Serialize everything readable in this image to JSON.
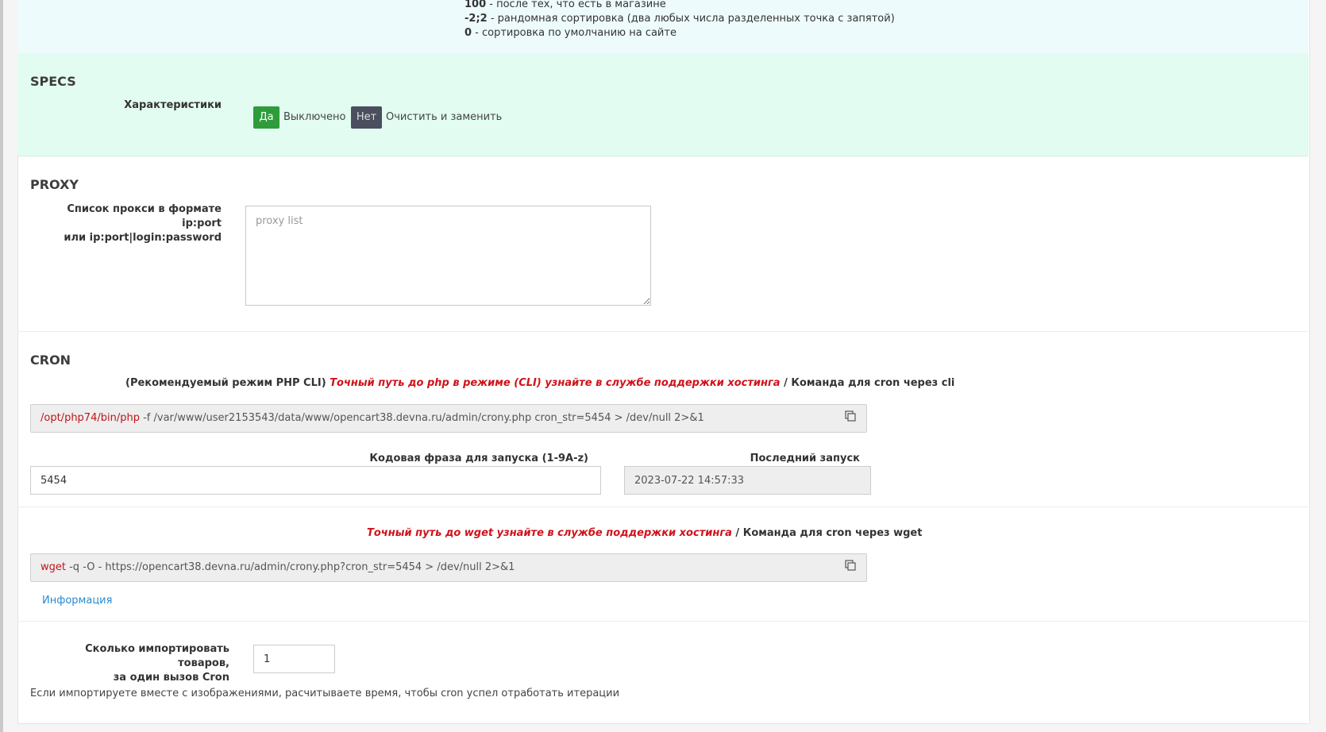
{
  "sort_help": [
    {
      "code": "100",
      "text": " - после тех, что есть в магазине"
    },
    {
      "code": "-2;2",
      "text": " - рандомная сортировка (два любых числа разделенных точка с запятой)"
    },
    {
      "code": "0",
      "text": " - сортировка по умолчанию на сайте"
    }
  ],
  "specs": {
    "title": "SPECS",
    "label": "Характеристики",
    "yes_button": "Да",
    "yes_text": "Выключено",
    "no_button": "Нет",
    "no_text": "Очистить и заменить"
  },
  "proxy": {
    "title": "PROXY",
    "label_line1": "Список прокси в формате ip:port",
    "label_line2": "или ip:port|login:password",
    "placeholder": "proxy list"
  },
  "cron": {
    "title": "CRON",
    "cli_hint_prefix": "(Рекомендуемый режим PHP CLI) ",
    "cli_hint_red": "Точный путь до php в режиме (CLI) узнайте в службе поддержки хостинга",
    "cli_hint_suffix": " / Команда для cron через cli",
    "cli_cmd_red": "/opt/php74/bin/php",
    "cli_cmd_rest": " -f /var/www/user2153543/data/www/opencart38.devna.ru/admin/crony.php cron_str=5454 > /dev/null 2>&1",
    "phrase_label": "Кодовая фраза для запуска (1-9A-z)",
    "phrase_value": "5454",
    "last_run_label": "Последний запуск",
    "last_run_value": "2023-07-22 14:57:33",
    "wget_hint_red": "Точный путь до wget узнайте в службе поддержки хостинга",
    "wget_hint_suffix": " / Команда для cron через wget",
    "wget_cmd_red": "wget",
    "wget_cmd_rest": " -q -O - https://opencart38.devna.ru/admin/crony.php?cron_str=5454 > /dev/null 2>&1",
    "info_link": "Информация",
    "import_label_line1": "Сколько импортировать товаров,",
    "import_label_line2": "за один вызов Cron",
    "import_value": "1",
    "footer_note": "Если импортируете вместе с изображениями, расчитываете время, чтобы cron успел отработать итерации"
  }
}
